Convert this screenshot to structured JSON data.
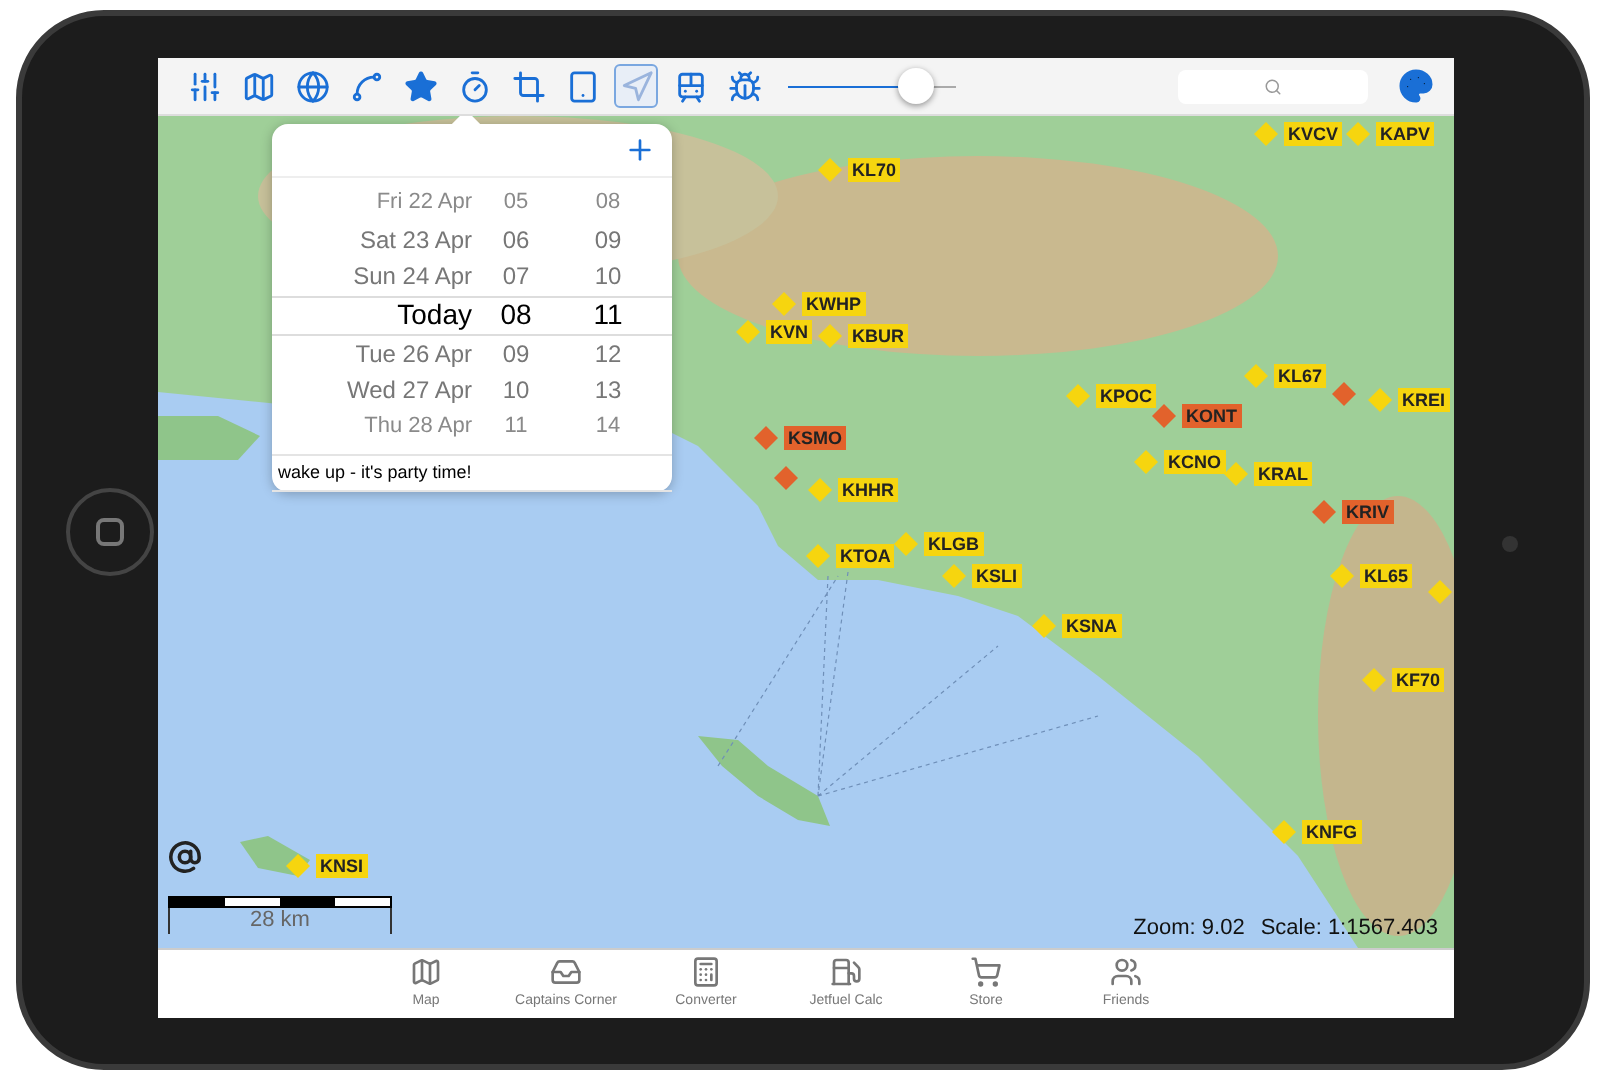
{
  "toolbar": {
    "tools": [
      {
        "selected": false
      },
      {
        "selected": false
      },
      {
        "selected": false
      },
      {
        "selected": false
      },
      {
        "selected": false
      },
      {
        "selected": false
      },
      {
        "selected": false
      },
      {
        "selected": false
      },
      {
        "selected": true
      },
      {
        "selected": false
      },
      {
        "selected": false
      }
    ],
    "slider": {
      "level": 0.76
    }
  },
  "popover": {
    "rows": [
      {
        "day": "Fri 22 Apr",
        "hour": "05",
        "minute": "08",
        "selected": false
      },
      {
        "day": "Sat 23 Apr",
        "hour": "06",
        "minute": "09",
        "selected": false
      },
      {
        "day": "Sun 24 Apr",
        "hour": "07",
        "minute": "10",
        "selected": false
      },
      {
        "day": "Today",
        "hour": "08",
        "minute": "11",
        "selected": true
      },
      {
        "day": "Tue 26 Apr",
        "hour": "09",
        "minute": "12",
        "selected": false
      },
      {
        "day": "Wed 27 Apr",
        "hour": "10",
        "minute": "13",
        "selected": false
      },
      {
        "day": "Thu 28 Apr",
        "hour": "11",
        "minute": "14",
        "selected": false
      }
    ],
    "note": "wake up - it's party time!"
  },
  "map": {
    "airports": [
      {
        "label": "KVCV",
        "color": "#f6d50f"
      },
      {
        "label": "KAPV",
        "color": "#f6d50f"
      },
      {
        "label": "KL70",
        "color": "#f6d50f"
      },
      {
        "label": "KWHP",
        "color": "#f6d50f"
      },
      {
        "label": "KVN",
        "color": "#f6d50f"
      },
      {
        "label": "KBUR",
        "color": "#f6d50f"
      },
      {
        "label": "KL67",
        "color": "#f6d50f"
      },
      {
        "label": "KPOC",
        "color": "#f6d50f"
      },
      {
        "label": "KONT",
        "color": "#e2622c"
      },
      {
        "color": "#e2622c"
      },
      {
        "label": "KREI",
        "color": "#f6d50f"
      },
      {
        "label": "KSMO",
        "color": "#e2622c"
      },
      {
        "color": "#e2622c"
      },
      {
        "label": "KHHR",
        "color": "#f6d50f"
      },
      {
        "label": "KCNO",
        "color": "#f6d50f"
      },
      {
        "label": "KRAL",
        "color": "#f6d50f"
      },
      {
        "label": "KRIV",
        "color": "#e2622c"
      },
      {
        "label": "KTOA",
        "color": "#f6d50f"
      },
      {
        "label": "KLGB",
        "color": "#f6d50f"
      },
      {
        "label": "KSLI",
        "color": "#f6d50f"
      },
      {
        "label": "KL65",
        "color": "#f6d50f"
      },
      {
        "color": "#f6d50f"
      },
      {
        "label": "KSNA",
        "color": "#f6d50f"
      },
      {
        "label": "KF70",
        "color": "#f6d50f"
      },
      {
        "label": "KNFG",
        "color": "#f6d50f"
      },
      {
        "label": "KNSI",
        "color": "#f6d50f"
      }
    ],
    "scale_label": "28 km",
    "zoom": "Zoom: 9.02",
    "scale": "Scale: 1:1567.403"
  },
  "tabs": [
    {
      "label": "Map",
      "selected": false
    },
    {
      "label": "Captains Corner",
      "selected": false
    },
    {
      "label": "Converter",
      "selected": false
    },
    {
      "label": "Jetfuel Calc",
      "selected": false
    },
    {
      "label": "Store",
      "selected": false
    },
    {
      "label": "Friends",
      "selected": false
    }
  ]
}
